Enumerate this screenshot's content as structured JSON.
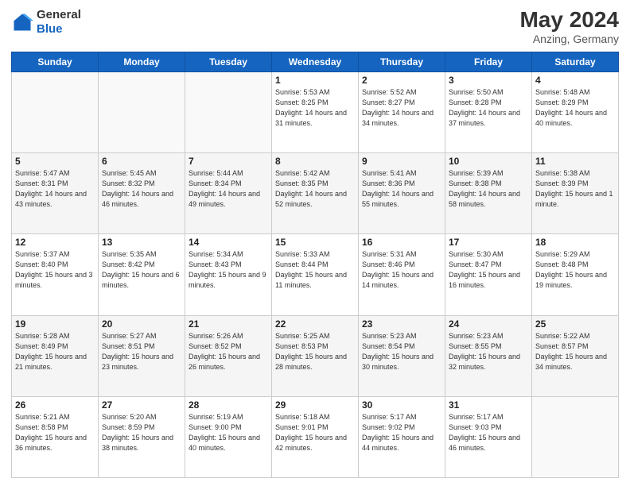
{
  "header": {
    "logo": {
      "general": "General",
      "blue": "Blue"
    },
    "title": "May 2024",
    "location": "Anzing, Germany"
  },
  "weekdays": [
    "Sunday",
    "Monday",
    "Tuesday",
    "Wednesday",
    "Thursday",
    "Friday",
    "Saturday"
  ],
  "weeks": [
    [
      {
        "day": "",
        "info": ""
      },
      {
        "day": "",
        "info": ""
      },
      {
        "day": "",
        "info": ""
      },
      {
        "day": "1",
        "info": "Sunrise: 5:53 AM\nSunset: 8:25 PM\nDaylight: 14 hours\nand 31 minutes."
      },
      {
        "day": "2",
        "info": "Sunrise: 5:52 AM\nSunset: 8:27 PM\nDaylight: 14 hours\nand 34 minutes."
      },
      {
        "day": "3",
        "info": "Sunrise: 5:50 AM\nSunset: 8:28 PM\nDaylight: 14 hours\nand 37 minutes."
      },
      {
        "day": "4",
        "info": "Sunrise: 5:48 AM\nSunset: 8:29 PM\nDaylight: 14 hours\nand 40 minutes."
      }
    ],
    [
      {
        "day": "5",
        "info": "Sunrise: 5:47 AM\nSunset: 8:31 PM\nDaylight: 14 hours\nand 43 minutes."
      },
      {
        "day": "6",
        "info": "Sunrise: 5:45 AM\nSunset: 8:32 PM\nDaylight: 14 hours\nand 46 minutes."
      },
      {
        "day": "7",
        "info": "Sunrise: 5:44 AM\nSunset: 8:34 PM\nDaylight: 14 hours\nand 49 minutes."
      },
      {
        "day": "8",
        "info": "Sunrise: 5:42 AM\nSunset: 8:35 PM\nDaylight: 14 hours\nand 52 minutes."
      },
      {
        "day": "9",
        "info": "Sunrise: 5:41 AM\nSunset: 8:36 PM\nDaylight: 14 hours\nand 55 minutes."
      },
      {
        "day": "10",
        "info": "Sunrise: 5:39 AM\nSunset: 8:38 PM\nDaylight: 14 hours\nand 58 minutes."
      },
      {
        "day": "11",
        "info": "Sunrise: 5:38 AM\nSunset: 8:39 PM\nDaylight: 15 hours\nand 1 minute."
      }
    ],
    [
      {
        "day": "12",
        "info": "Sunrise: 5:37 AM\nSunset: 8:40 PM\nDaylight: 15 hours\nand 3 minutes."
      },
      {
        "day": "13",
        "info": "Sunrise: 5:35 AM\nSunset: 8:42 PM\nDaylight: 15 hours\nand 6 minutes."
      },
      {
        "day": "14",
        "info": "Sunrise: 5:34 AM\nSunset: 8:43 PM\nDaylight: 15 hours\nand 9 minutes."
      },
      {
        "day": "15",
        "info": "Sunrise: 5:33 AM\nSunset: 8:44 PM\nDaylight: 15 hours\nand 11 minutes."
      },
      {
        "day": "16",
        "info": "Sunrise: 5:31 AM\nSunset: 8:46 PM\nDaylight: 15 hours\nand 14 minutes."
      },
      {
        "day": "17",
        "info": "Sunrise: 5:30 AM\nSunset: 8:47 PM\nDaylight: 15 hours\nand 16 minutes."
      },
      {
        "day": "18",
        "info": "Sunrise: 5:29 AM\nSunset: 8:48 PM\nDaylight: 15 hours\nand 19 minutes."
      }
    ],
    [
      {
        "day": "19",
        "info": "Sunrise: 5:28 AM\nSunset: 8:49 PM\nDaylight: 15 hours\nand 21 minutes."
      },
      {
        "day": "20",
        "info": "Sunrise: 5:27 AM\nSunset: 8:51 PM\nDaylight: 15 hours\nand 23 minutes."
      },
      {
        "day": "21",
        "info": "Sunrise: 5:26 AM\nSunset: 8:52 PM\nDaylight: 15 hours\nand 26 minutes."
      },
      {
        "day": "22",
        "info": "Sunrise: 5:25 AM\nSunset: 8:53 PM\nDaylight: 15 hours\nand 28 minutes."
      },
      {
        "day": "23",
        "info": "Sunrise: 5:23 AM\nSunset: 8:54 PM\nDaylight: 15 hours\nand 30 minutes."
      },
      {
        "day": "24",
        "info": "Sunrise: 5:23 AM\nSunset: 8:55 PM\nDaylight: 15 hours\nand 32 minutes."
      },
      {
        "day": "25",
        "info": "Sunrise: 5:22 AM\nSunset: 8:57 PM\nDaylight: 15 hours\nand 34 minutes."
      }
    ],
    [
      {
        "day": "26",
        "info": "Sunrise: 5:21 AM\nSunset: 8:58 PM\nDaylight: 15 hours\nand 36 minutes."
      },
      {
        "day": "27",
        "info": "Sunrise: 5:20 AM\nSunset: 8:59 PM\nDaylight: 15 hours\nand 38 minutes."
      },
      {
        "day": "28",
        "info": "Sunrise: 5:19 AM\nSunset: 9:00 PM\nDaylight: 15 hours\nand 40 minutes."
      },
      {
        "day": "29",
        "info": "Sunrise: 5:18 AM\nSunset: 9:01 PM\nDaylight: 15 hours\nand 42 minutes."
      },
      {
        "day": "30",
        "info": "Sunrise: 5:17 AM\nSunset: 9:02 PM\nDaylight: 15 hours\nand 44 minutes."
      },
      {
        "day": "31",
        "info": "Sunrise: 5:17 AM\nSunset: 9:03 PM\nDaylight: 15 hours\nand 46 minutes."
      },
      {
        "day": "",
        "info": ""
      }
    ]
  ]
}
